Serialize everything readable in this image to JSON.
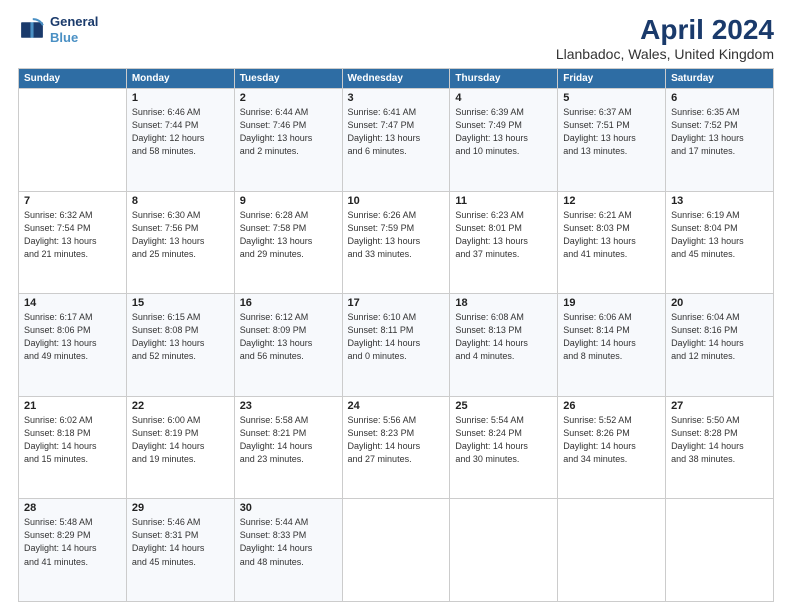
{
  "logo": {
    "line1": "General",
    "line2": "Blue"
  },
  "title": "April 2024",
  "subtitle": "Llanbadoc, Wales, United Kingdom",
  "weekdays": [
    "Sunday",
    "Monday",
    "Tuesday",
    "Wednesday",
    "Thursday",
    "Friday",
    "Saturday"
  ],
  "weeks": [
    [
      {
        "day": "",
        "info": ""
      },
      {
        "day": "1",
        "info": "Sunrise: 6:46 AM\nSunset: 7:44 PM\nDaylight: 12 hours\nand 58 minutes."
      },
      {
        "day": "2",
        "info": "Sunrise: 6:44 AM\nSunset: 7:46 PM\nDaylight: 13 hours\nand 2 minutes."
      },
      {
        "day": "3",
        "info": "Sunrise: 6:41 AM\nSunset: 7:47 PM\nDaylight: 13 hours\nand 6 minutes."
      },
      {
        "day": "4",
        "info": "Sunrise: 6:39 AM\nSunset: 7:49 PM\nDaylight: 13 hours\nand 10 minutes."
      },
      {
        "day": "5",
        "info": "Sunrise: 6:37 AM\nSunset: 7:51 PM\nDaylight: 13 hours\nand 13 minutes."
      },
      {
        "day": "6",
        "info": "Sunrise: 6:35 AM\nSunset: 7:52 PM\nDaylight: 13 hours\nand 17 minutes."
      }
    ],
    [
      {
        "day": "7",
        "info": "Sunrise: 6:32 AM\nSunset: 7:54 PM\nDaylight: 13 hours\nand 21 minutes."
      },
      {
        "day": "8",
        "info": "Sunrise: 6:30 AM\nSunset: 7:56 PM\nDaylight: 13 hours\nand 25 minutes."
      },
      {
        "day": "9",
        "info": "Sunrise: 6:28 AM\nSunset: 7:58 PM\nDaylight: 13 hours\nand 29 minutes."
      },
      {
        "day": "10",
        "info": "Sunrise: 6:26 AM\nSunset: 7:59 PM\nDaylight: 13 hours\nand 33 minutes."
      },
      {
        "day": "11",
        "info": "Sunrise: 6:23 AM\nSunset: 8:01 PM\nDaylight: 13 hours\nand 37 minutes."
      },
      {
        "day": "12",
        "info": "Sunrise: 6:21 AM\nSunset: 8:03 PM\nDaylight: 13 hours\nand 41 minutes."
      },
      {
        "day": "13",
        "info": "Sunrise: 6:19 AM\nSunset: 8:04 PM\nDaylight: 13 hours\nand 45 minutes."
      }
    ],
    [
      {
        "day": "14",
        "info": "Sunrise: 6:17 AM\nSunset: 8:06 PM\nDaylight: 13 hours\nand 49 minutes."
      },
      {
        "day": "15",
        "info": "Sunrise: 6:15 AM\nSunset: 8:08 PM\nDaylight: 13 hours\nand 52 minutes."
      },
      {
        "day": "16",
        "info": "Sunrise: 6:12 AM\nSunset: 8:09 PM\nDaylight: 13 hours\nand 56 minutes."
      },
      {
        "day": "17",
        "info": "Sunrise: 6:10 AM\nSunset: 8:11 PM\nDaylight: 14 hours\nand 0 minutes."
      },
      {
        "day": "18",
        "info": "Sunrise: 6:08 AM\nSunset: 8:13 PM\nDaylight: 14 hours\nand 4 minutes."
      },
      {
        "day": "19",
        "info": "Sunrise: 6:06 AM\nSunset: 8:14 PM\nDaylight: 14 hours\nand 8 minutes."
      },
      {
        "day": "20",
        "info": "Sunrise: 6:04 AM\nSunset: 8:16 PM\nDaylight: 14 hours\nand 12 minutes."
      }
    ],
    [
      {
        "day": "21",
        "info": "Sunrise: 6:02 AM\nSunset: 8:18 PM\nDaylight: 14 hours\nand 15 minutes."
      },
      {
        "day": "22",
        "info": "Sunrise: 6:00 AM\nSunset: 8:19 PM\nDaylight: 14 hours\nand 19 minutes."
      },
      {
        "day": "23",
        "info": "Sunrise: 5:58 AM\nSunset: 8:21 PM\nDaylight: 14 hours\nand 23 minutes."
      },
      {
        "day": "24",
        "info": "Sunrise: 5:56 AM\nSunset: 8:23 PM\nDaylight: 14 hours\nand 27 minutes."
      },
      {
        "day": "25",
        "info": "Sunrise: 5:54 AM\nSunset: 8:24 PM\nDaylight: 14 hours\nand 30 minutes."
      },
      {
        "day": "26",
        "info": "Sunrise: 5:52 AM\nSunset: 8:26 PM\nDaylight: 14 hours\nand 34 minutes."
      },
      {
        "day": "27",
        "info": "Sunrise: 5:50 AM\nSunset: 8:28 PM\nDaylight: 14 hours\nand 38 minutes."
      }
    ],
    [
      {
        "day": "28",
        "info": "Sunrise: 5:48 AM\nSunset: 8:29 PM\nDaylight: 14 hours\nand 41 minutes."
      },
      {
        "day": "29",
        "info": "Sunrise: 5:46 AM\nSunset: 8:31 PM\nDaylight: 14 hours\nand 45 minutes."
      },
      {
        "day": "30",
        "info": "Sunrise: 5:44 AM\nSunset: 8:33 PM\nDaylight: 14 hours\nand 48 minutes."
      },
      {
        "day": "",
        "info": ""
      },
      {
        "day": "",
        "info": ""
      },
      {
        "day": "",
        "info": ""
      },
      {
        "day": "",
        "info": ""
      }
    ]
  ]
}
